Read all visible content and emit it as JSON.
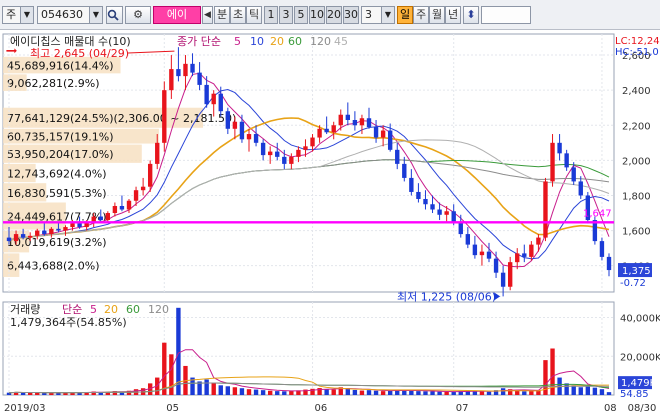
{
  "toolbar": {
    "market": "주",
    "code": "054630",
    "stock_name": "에이",
    "ticks": [
      "분",
      "초",
      "틱"
    ],
    "periods": [
      "1",
      "3",
      "5",
      "10",
      "20",
      "30"
    ],
    "interval_value": "3",
    "day_tab": "일",
    "other_tabs": [
      "주",
      "월",
      "년"
    ],
    "prev_arrow": "◀",
    "move_arrow": "⬍"
  },
  "colors": {
    "up": "#e8141c",
    "down": "#1a3ad6",
    "ma5": "#c81e8c",
    "ma10": "#2b45d8",
    "ma20": "#e8a317",
    "ma60": "#3a9a3a",
    "ma120": "#8c8c8c",
    "ma45": "#b0b0b0",
    "level_line": "#ff00ff",
    "band": "#f7e0c2"
  },
  "chart_data": [
    {
      "type": "candlestick",
      "title": "에이디칩스 매물대 수(10)",
      "ma_label": "종가 단순",
      "ma_periods": [
        "5",
        "10",
        "20",
        "60",
        "120",
        "45"
      ],
      "y_ticks": [
        "2,600",
        "2,400",
        "2,200",
        "2,000",
        "1,800",
        "1,600",
        "1,400"
      ],
      "ylim": [
        1250,
        2720
      ],
      "x_ticks": [
        "2019/03",
        "05",
        "06",
        "07",
        "08",
        "08/30"
      ],
      "right_labels": {
        "lc": "LC:12,24",
        "hc": "HC:-51,0"
      },
      "max_label": "최고 2,645 (04/29)",
      "min_label": "최저 1,225 (08/06)",
      "current_price": "1,375",
      "current_change": "-0.72",
      "level_value": 1647,
      "level_label": "1,647",
      "volume_profile": [
        {
          "label": "45,689,916(14.4%)",
          "low": 2490,
          "high": 2590,
          "ratio": 0.144
        },
        {
          "label": "9,062,281(2.9%)",
          "low": 2390,
          "high": 2490,
          "ratio": 0.029
        },
        {
          "label": "77,641,129(24.5%)(2,306.00 ~ 2,181.50)",
          "low": 2180,
          "high": 2300,
          "ratio": 0.245
        },
        {
          "label": "60,735,157(19.1%)",
          "low": 2090,
          "high": 2180,
          "ratio": 0.191
        },
        {
          "label": "53,950,204(17.0%)",
          "low": 1980,
          "high": 2090,
          "ratio": 0.17
        },
        {
          "label": "12,743,692(4.0%)",
          "low": 1870,
          "high": 1980,
          "ratio": 0.04
        },
        {
          "label": "16,830,591(5.3%)",
          "low": 1760,
          "high": 1870,
          "ratio": 0.053
        },
        {
          "label": "24,449,617(7.7%)",
          "low": 1600,
          "high": 1760,
          "ratio": 0.077
        },
        {
          "label": "10,019,619(3.2%)",
          "low": 1470,
          "high": 1600,
          "ratio": 0.032
        },
        {
          "label": "6,443,688(2.0%)",
          "low": 1330,
          "high": 1470,
          "ratio": 0.02
        }
      ],
      "candles": [
        [
          1560,
          1620,
          1520,
          1540
        ],
        [
          1540,
          1600,
          1520,
          1580
        ],
        [
          1580,
          1610,
          1550,
          1560
        ],
        [
          1560,
          1590,
          1540,
          1570
        ],
        [
          1570,
          1610,
          1550,
          1600
        ],
        [
          1600,
          1640,
          1570,
          1580
        ],
        [
          1580,
          1620,
          1560,
          1610
        ],
        [
          1610,
          1650,
          1590,
          1600
        ],
        [
          1600,
          1630,
          1570,
          1620
        ],
        [
          1620,
          1660,
          1600,
          1640
        ],
        [
          1640,
          1680,
          1610,
          1620
        ],
        [
          1620,
          1660,
          1600,
          1650
        ],
        [
          1650,
          1700,
          1620,
          1680
        ],
        [
          1680,
          1720,
          1650,
          1660
        ],
        [
          1660,
          1710,
          1640,
          1700
        ],
        [
          1700,
          1760,
          1680,
          1740
        ],
        [
          1740,
          1800,
          1710,
          1720
        ],
        [
          1720,
          1780,
          1700,
          1770
        ],
        [
          1770,
          1850,
          1740,
          1830
        ],
        [
          1830,
          1900,
          1800,
          1850
        ],
        [
          1850,
          2000,
          1820,
          1980
        ],
        [
          1980,
          2150,
          1950,
          2100
        ],
        [
          2100,
          2450,
          2050,
          2400
        ],
        [
          2400,
          2600,
          2350,
          2520
        ],
        [
          2520,
          2645,
          2450,
          2480
        ],
        [
          2480,
          2600,
          2400,
          2550
        ],
        [
          2550,
          2610,
          2480,
          2500
        ],
        [
          2500,
          2560,
          2400,
          2430
        ],
        [
          2430,
          2480,
          2300,
          2320
        ],
        [
          2320,
          2400,
          2250,
          2380
        ],
        [
          2380,
          2420,
          2250,
          2280
        ],
        [
          2280,
          2300,
          2150,
          2180
        ],
        [
          2180,
          2250,
          2120,
          2220
        ],
        [
          2220,
          2260,
          2100,
          2120
        ],
        [
          2120,
          2180,
          2050,
          2150
        ],
        [
          2150,
          2200,
          2080,
          2100
        ],
        [
          2100,
          2120,
          2000,
          2030
        ],
        [
          2030,
          2080,
          1980,
          2050
        ],
        [
          2050,
          2100,
          2000,
          2020
        ],
        [
          2020,
          2060,
          1950,
          1980
        ],
        [
          1980,
          2040,
          1950,
          2020
        ],
        [
          2020,
          2080,
          1990,
          2060
        ],
        [
          2060,
          2120,
          2020,
          2080
        ],
        [
          2080,
          2150,
          2050,
          2130
        ],
        [
          2130,
          2200,
          2100,
          2180
        ],
        [
          2180,
          2250,
          2150,
          2160
        ],
        [
          2160,
          2220,
          2120,
          2200
        ],
        [
          2200,
          2290,
          2170,
          2260
        ],
        [
          2260,
          2330,
          2200,
          2230
        ],
        [
          2230,
          2280,
          2170,
          2200
        ],
        [
          2200,
          2260,
          2150,
          2240
        ],
        [
          2240,
          2300,
          2180,
          2190
        ],
        [
          2190,
          2230,
          2100,
          2130
        ],
        [
          2130,
          2200,
          2080,
          2170
        ],
        [
          2170,
          2210,
          2050,
          2060
        ],
        [
          2060,
          2100,
          1950,
          1980
        ],
        [
          1980,
          2020,
          1880,
          1900
        ],
        [
          1900,
          1950,
          1800,
          1820
        ],
        [
          1820,
          1870,
          1760,
          1780
        ],
        [
          1780,
          1830,
          1720,
          1750
        ],
        [
          1750,
          1800,
          1700,
          1720
        ],
        [
          1720,
          1760,
          1660,
          1690
        ],
        [
          1690,
          1740,
          1650,
          1710
        ],
        [
          1710,
          1750,
          1630,
          1650
        ],
        [
          1650,
          1690,
          1560,
          1580
        ],
        [
          1580,
          1620,
          1500,
          1520
        ],
        [
          1520,
          1570,
          1440,
          1460
        ],
        [
          1460,
          1520,
          1400,
          1480
        ],
        [
          1480,
          1530,
          1420,
          1440
        ],
        [
          1440,
          1480,
          1330,
          1360
        ],
        [
          1360,
          1400,
          1225,
          1280
        ],
        [
          1280,
          1450,
          1260,
          1420
        ],
        [
          1420,
          1500,
          1380,
          1470
        ],
        [
          1470,
          1520,
          1420,
          1450
        ],
        [
          1450,
          1540,
          1430,
          1520
        ],
        [
          1520,
          1580,
          1480,
          1560
        ],
        [
          1560,
          1900,
          1540,
          1880
        ],
        [
          1880,
          2150,
          1850,
          2100
        ],
        [
          2100,
          2150,
          2000,
          2040
        ],
        [
          2040,
          2060,
          1940,
          1960
        ],
        [
          1960,
          1990,
          1860,
          1880
        ],
        [
          1880,
          1910,
          1780,
          1800
        ],
        [
          1800,
          1820,
          1640,
          1660
        ],
        [
          1660,
          1680,
          1520,
          1540
        ],
        [
          1540,
          1560,
          1430,
          1450
        ],
        [
          1450,
          1470,
          1340,
          1375
        ]
      ]
    },
    {
      "type": "bar",
      "title": "거래량",
      "ma_label": "단순",
      "ma_periods": [
        "5",
        "20",
        "60",
        "120"
      ],
      "volume_text": "1,479,364주(54.85%)",
      "y_ticks": [
        "40,000K",
        "20,000K"
      ],
      "ylim": [
        0,
        48000
      ],
      "current_volume": "1,479K",
      "current_ratio": "54.85",
      "volumes": [
        1200,
        1500,
        1100,
        1300,
        1400,
        1000,
        1200,
        1300,
        1100,
        1400,
        1200,
        1500,
        1800,
        1300,
        1600,
        2000,
        1700,
        2200,
        3000,
        3500,
        6000,
        9000,
        27000,
        21000,
        45000,
        15000,
        9000,
        7000,
        8000,
        6000,
        5000,
        4500,
        4000,
        3500,
        3000,
        2800,
        2500,
        2200,
        2000,
        1900,
        2100,
        2400,
        2800,
        3200,
        3600,
        3000,
        2800,
        4000,
        3500,
        2600,
        2300,
        2500,
        2200,
        2000,
        2300,
        2600,
        2400,
        2200,
        2000,
        1900,
        1800,
        1700,
        1600,
        1800,
        2000,
        2200,
        1900,
        1800,
        1700,
        2500,
        3500,
        3000,
        2200,
        1900,
        2100,
        2600,
        18000,
        24000,
        9000,
        6000,
        5000,
        4000,
        4500,
        3800,
        3000,
        1479
      ]
    }
  ]
}
